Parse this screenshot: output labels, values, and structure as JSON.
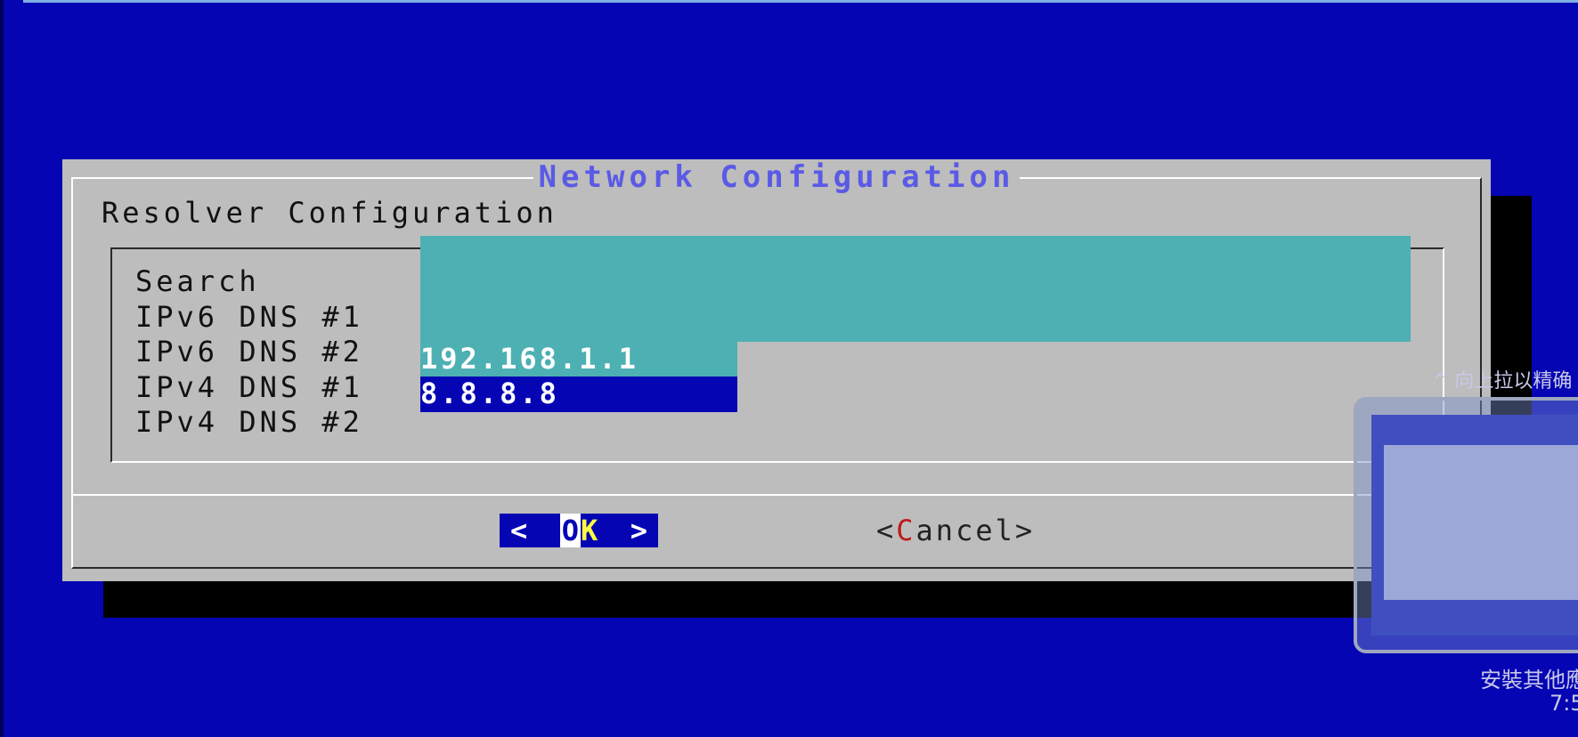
{
  "dialog": {
    "title": "Network Configuration",
    "subtitle": "Resolver Configuration"
  },
  "form": {
    "fields": [
      {
        "label": "Search",
        "value": ""
      },
      {
        "label": "IPv6 DNS #1",
        "value": ""
      },
      {
        "label": "IPv6 DNS #2",
        "value": ""
      },
      {
        "label": "IPv4 DNS #1",
        "value": "192.168.1.1"
      },
      {
        "label": "IPv4 DNS #2",
        "value": "8.8.8.8"
      }
    ]
  },
  "buttons": {
    "ok": {
      "left_bracket": "<",
      "hotkey": "O",
      "rest": "K",
      "right_bracket": ">"
    },
    "cancel": {
      "left_bracket": "<",
      "hotkey": "C",
      "rest": "ancel",
      "right_bracket": ">"
    }
  },
  "overlay": {
    "hint": "⌃ 向上拉以精确",
    "caption": "安裝其他應",
    "time": "7:5"
  },
  "colors": {
    "background": "#0505b4",
    "dialog": "#bdbdbd",
    "field_inactive": "#4db0b3",
    "title": "#5a5ae6",
    "hotkey_highlight": "#c01818"
  }
}
